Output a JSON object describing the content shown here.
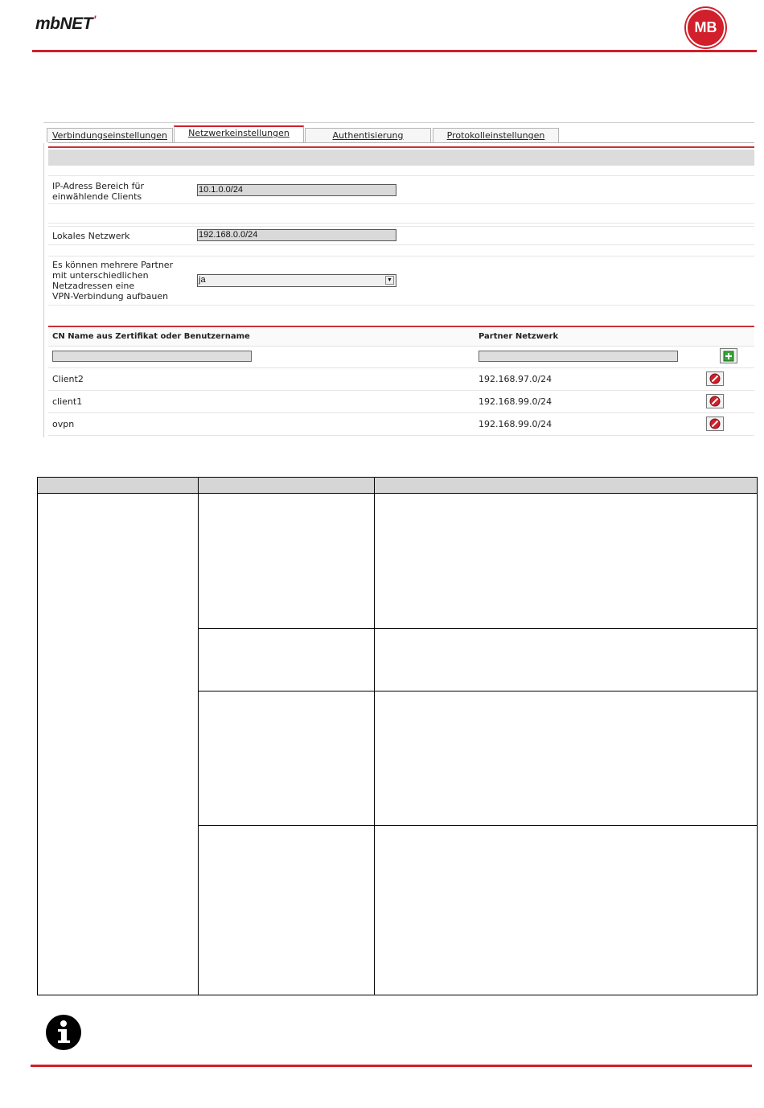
{
  "header": {
    "logo_text": "mbNET",
    "logo_mark": "'",
    "badge_text": "MB",
    "accent_color": "#d11f2b"
  },
  "tabs": [
    {
      "label": "Verbindungseinstellungen",
      "active": false
    },
    {
      "label": "Netzwerkeinstellungen",
      "active": true
    },
    {
      "label": "Authentisierung",
      "active": false
    },
    {
      "label": "Protokolleinstellungen",
      "active": false
    }
  ],
  "form": {
    "ip_range": {
      "label_line1": "IP-Adress Bereich für",
      "label_line2": "einwählende Clients",
      "value": "10.1.0.0/24"
    },
    "local_network": {
      "label": "Lokales Netzwerk",
      "value": "192.168.0.0/24"
    },
    "multi_partner": {
      "label_lines": [
        "Es können mehrere Partner",
        "mit unterschiedlichen",
        "Netzadressen eine",
        "VPN-Verbindung aufbauen"
      ],
      "selected": "ja"
    }
  },
  "partner_table": {
    "col_cn": "CN Name aus Zertifikat oder Benutzername",
    "col_network": "Partner Netzwerk",
    "new_cn": "",
    "new_network": "",
    "rows": [
      {
        "cn": "Client2",
        "network": "192.168.97.0/24"
      },
      {
        "cn": "client1",
        "network": "192.168.99.0/24"
      },
      {
        "cn": "ovpn",
        "network": "192.168.99.0/24"
      }
    ]
  }
}
